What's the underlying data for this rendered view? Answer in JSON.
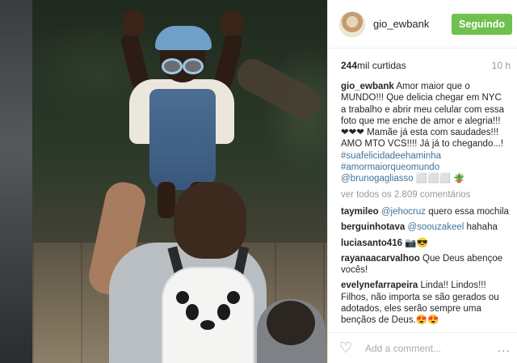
{
  "post": {
    "username": "gio_ewbank",
    "follow_button": "Seguindo",
    "likes_count": "244",
    "likes_unit": "mil curtidas",
    "time": "10 h"
  },
  "caption": {
    "username": "gio_ewbank",
    "text": "Amor maior que o MUNDO!!! Que delicia chegar em NYC a trabalho e abrir meu celular com essa foto que me enche de amor e alegria!!! ❤❤❤ Mamãe já esta com saudades!!! AMO MTO VCS!!!! Já já to chegando...!",
    "hashtag1": "#suafelicidadeehaminha",
    "hashtag2": "#amormaiorqueomundo",
    "mention": "@brunogagliasso",
    "emoji": " ⬜⬜⬜ 🪴"
  },
  "view_all": "ver todos os 2.809 comentários",
  "comments": [
    {
      "user": "taymileo",
      "mention": "@jehocruz",
      "text": " quero essa mochila"
    },
    {
      "user": "berguinhotava",
      "mention": "@soouzakeel",
      "text": " hahaha"
    },
    {
      "user": "luciasanto416",
      "text": "📷😎"
    },
    {
      "user": "rayanaacarvalhoo",
      "text": "Que Deus abençoe vocês!"
    },
    {
      "user": "evelynefarrapeira",
      "text": "Linda!! Lindos!!! Filhos, não importa se são gerados ou adotados, eles serão sempre uma bençãos de Deus.😍😍"
    }
  ],
  "footer": {
    "add_comment_placeholder": "Add a comment...",
    "more": "..."
  },
  "icons": {
    "like": "heart-icon",
    "options": "more-options-icon"
  },
  "colors": {
    "follow": "#70c050",
    "link": "#3f729b"
  }
}
